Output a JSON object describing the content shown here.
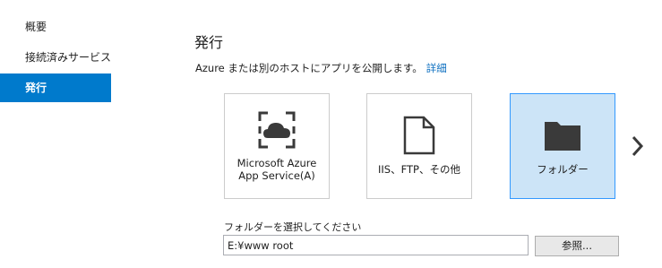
{
  "sidebar": {
    "items": [
      {
        "label": "概要"
      },
      {
        "label": "接続済みサービス"
      },
      {
        "label": "発行"
      }
    ]
  },
  "main": {
    "title": "発行",
    "description": "Azure または別のホストにアプリを公開します。",
    "details_link": "詳細",
    "targets": [
      {
        "label_line1": "Microsoft Azure",
        "label_line2": "App Service(A)",
        "icon": "azure-cloud-icon"
      },
      {
        "label": "IIS、FTP、その他",
        "icon": "document-icon"
      },
      {
        "label": "フォルダー",
        "icon": "folder-icon",
        "selected": true
      }
    ],
    "folder_label": "フォルダーを選択してください",
    "folder_value": "E:¥www root",
    "browse_label": "参照..."
  },
  "colors": {
    "accent": "#007acc",
    "selected_tile": "#cce4f7",
    "link": "#0e70c0"
  }
}
